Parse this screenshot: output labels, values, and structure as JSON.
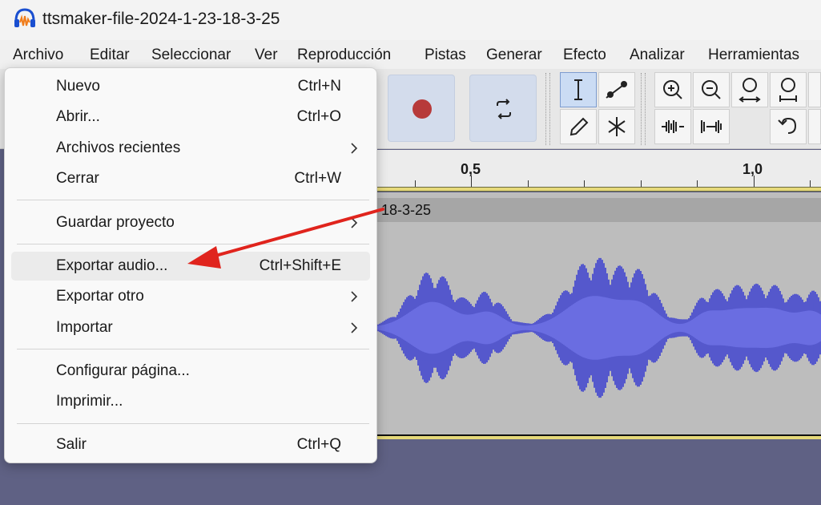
{
  "window": {
    "title": "ttsmaker-file-2024-1-23-18-3-25"
  },
  "menubar": {
    "items": [
      {
        "label": "Archivo"
      },
      {
        "label": "Editar"
      },
      {
        "label": "Seleccionar"
      },
      {
        "label": "Ver"
      },
      {
        "label": "Reproducción"
      },
      {
        "label": "Pistas"
      },
      {
        "label": "Generar"
      },
      {
        "label": "Efecto"
      },
      {
        "label": "Analizar"
      },
      {
        "label": "Herramientas"
      }
    ]
  },
  "file_menu": {
    "items": [
      {
        "label": "Nuevo",
        "shortcut": "Ctrl+N"
      },
      {
        "label": "Abrir...",
        "shortcut": "Ctrl+O"
      },
      {
        "label": "Archivos recientes",
        "shortcut": ""
      },
      {
        "label": "Cerrar",
        "shortcut": "Ctrl+W"
      },
      {
        "label": "Guardar proyecto",
        "shortcut": ""
      },
      {
        "label": "Exportar audio...",
        "shortcut": "Ctrl+Shift+E"
      },
      {
        "label": "Exportar otro",
        "shortcut": ""
      },
      {
        "label": "Importar",
        "shortcut": ""
      },
      {
        "label": "Configurar página...",
        "shortcut": ""
      },
      {
        "label": "Imprimir...",
        "shortcut": ""
      },
      {
        "label": "Salir",
        "shortcut": "Ctrl+Q"
      }
    ]
  },
  "ruler": {
    "labels": [
      "0,5",
      "1,0"
    ]
  },
  "track": {
    "name": "-18-3-25"
  },
  "colors": {
    "waveform": "#3b3fd0",
    "record": "#b73a3a",
    "annotation_arrow": "#e0241d",
    "background": "#5f6184"
  },
  "icons": [
    "audacity-logo-icon",
    "record-icon",
    "loop-icon",
    "selection-tool-icon",
    "envelope-tool-icon",
    "draw-tool-icon",
    "multi-tool-icon",
    "zoom-in-icon",
    "zoom-out-icon",
    "fit-selection-icon",
    "fit-project-icon",
    "trim-icon",
    "silence-icon",
    "undo-icon"
  ]
}
